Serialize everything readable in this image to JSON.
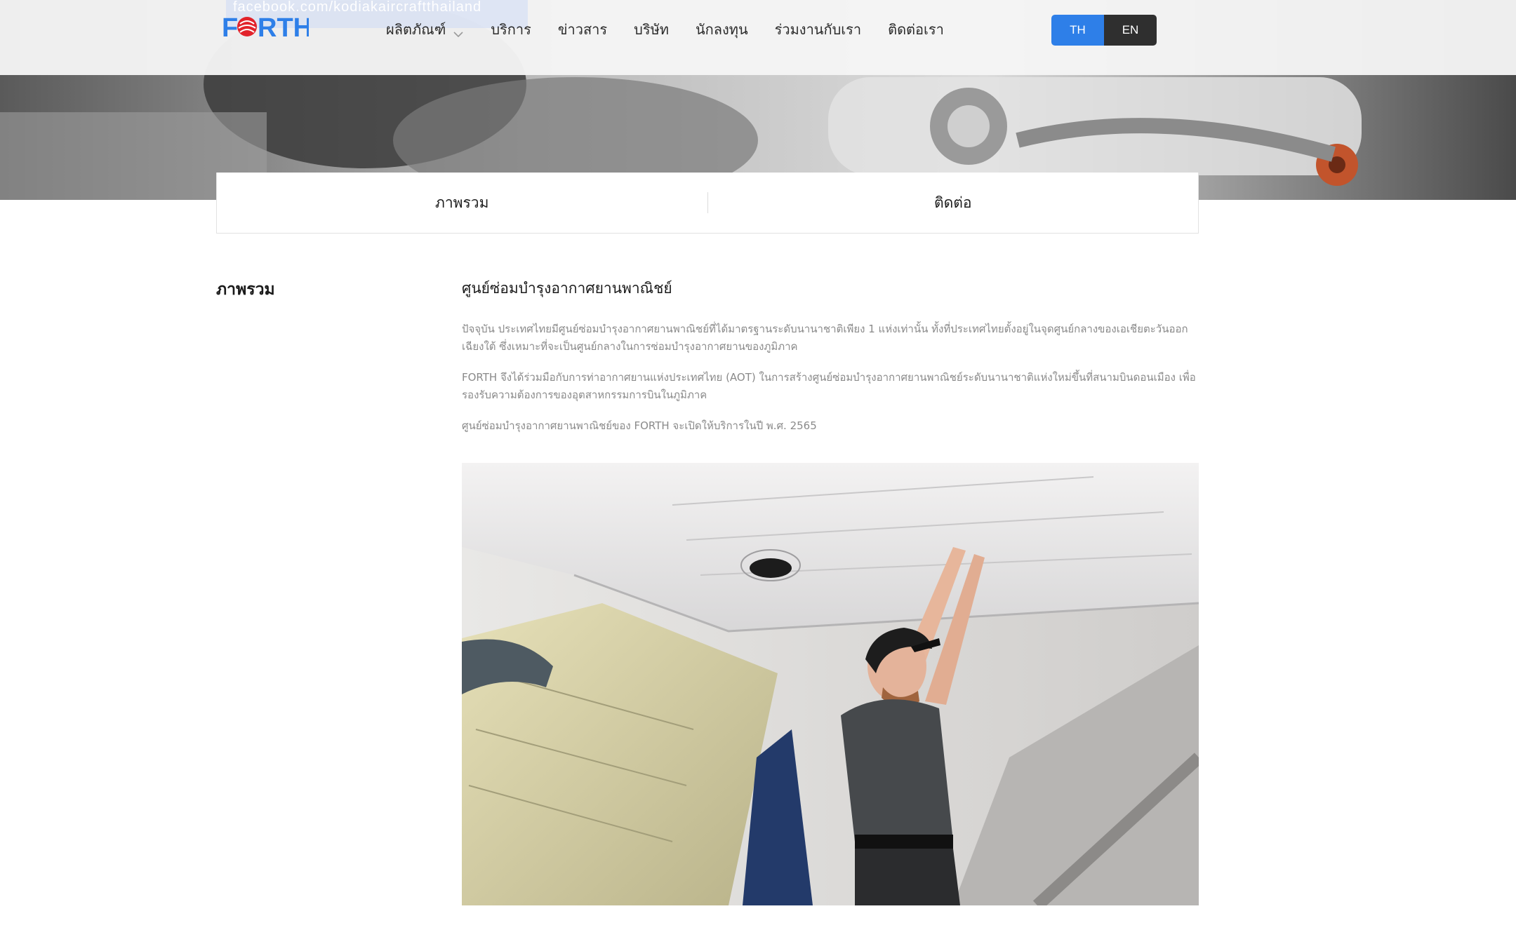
{
  "header": {
    "watermark": "facebook.com/kodiakaircraftthailand",
    "logo_text": "FORTH",
    "nav": [
      {
        "label": "ผลิตภัณฑ์",
        "has_dropdown": true
      },
      {
        "label": "บริการ"
      },
      {
        "label": "ข่าวสาร"
      },
      {
        "label": "บริษัท"
      },
      {
        "label": "นักลงทุน"
      },
      {
        "label": "ร่วมงานกับเรา"
      },
      {
        "label": "ติดต่อเรา"
      }
    ],
    "lang": {
      "th": "TH",
      "en": "EN",
      "active": "TH"
    }
  },
  "tabs": [
    {
      "label": "ภาพรวม"
    },
    {
      "label": "ติดต่อ"
    }
  ],
  "section": {
    "label": "ภาพรวม",
    "title": "ศูนย์ซ่อมบำรุงอากาศยานพาณิชย์",
    "paragraphs": [
      "ปัจจุบัน ประเทศไทยมีศูนย์ซ่อมบำรุงอากาศยานพาณิชย์ที่ได้มาตรฐานระดับนานาชาติเพียง 1 แห่งเท่านั้น ทั้งที่ประเทศไทยตั้งอยู่ในจุดศูนย์กลางของเอเชียตะวันออกเฉียงใต้ ซึ่งเหมาะที่จะเป็นศูนย์กลางในการซ่อมบำรุงอากาศยานของภูมิภาค",
      "FORTH จึงได้ร่วมมือกับการท่าอากาศยานแห่งประเทศไทย (AOT) ในการสร้างศูนย์ซ่อมบำรุงอากาศยานพาณิชย์ระดับนานาชาติแห่งใหม่ขึ้นที่สนามบินดอนเมือง เพื่อรองรับความต้องการของอุตสาหกรรมการบินในภูมิภาค",
      "ศูนย์ซ่อมบำรุงอากาศยานพาณิชย์ของ FORTH จะเปิดให้บริการในปี พ.ศ. 2565"
    ]
  },
  "colors": {
    "brand_blue": "#2e7fe8",
    "brand_red": "#e2232b",
    "lang_dark": "#2f2f2f"
  },
  "icons": {
    "dropdown": "chevron-down-icon"
  }
}
